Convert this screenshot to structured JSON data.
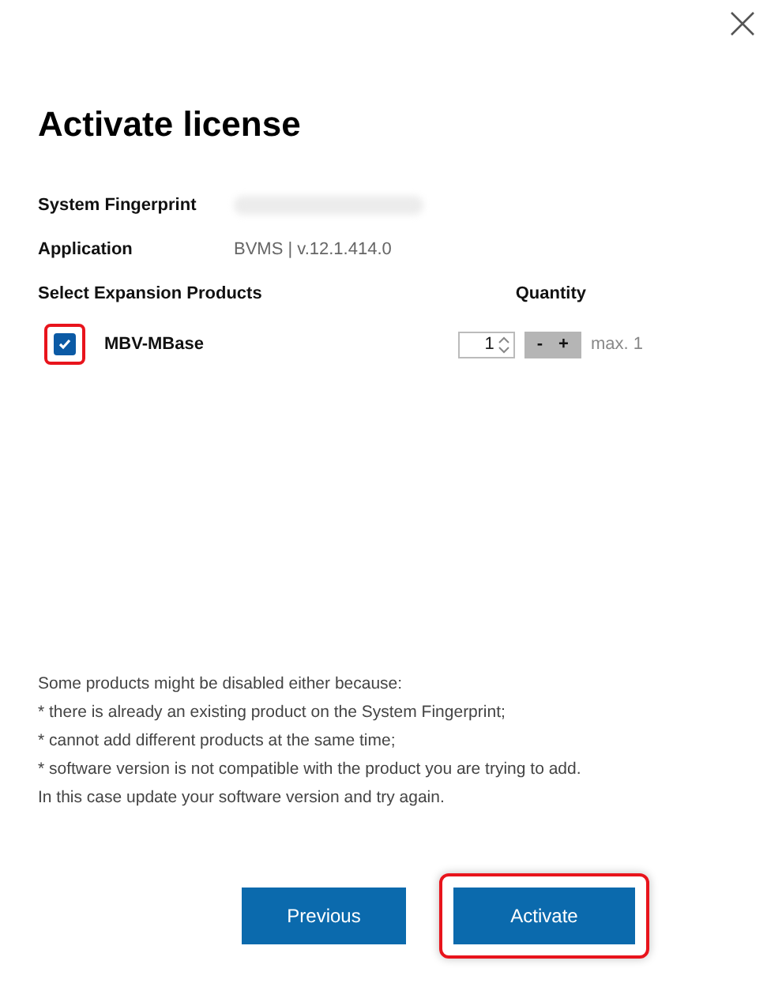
{
  "title": "Activate license",
  "info": [
    {
      "label": "System Fingerprint",
      "kind": "blurred"
    },
    {
      "label": "Application",
      "kind": "text",
      "value": "BVMS | v.12.1.414.0"
    }
  ],
  "products_header": {
    "label": "Select Expansion Products",
    "quantity_label": "Quantity"
  },
  "products": [
    {
      "name": "MBV-MBase",
      "checked": true,
      "highlighted": true,
      "quantity": "1",
      "minus": "-",
      "plus": "+",
      "max": "max. 1"
    }
  ],
  "notes": [
    "Some products might be disabled either because:",
    "* there is already an existing product on the System Fingerprint;",
    "* cannot add different products at the same time;",
    "* software version is not compatible with the product you are trying to add.",
    "In this case update your software version and try again."
  ],
  "buttons": [
    {
      "label": "Previous",
      "highlighted": false
    },
    {
      "label": "Activate",
      "highlighted": true
    }
  ]
}
